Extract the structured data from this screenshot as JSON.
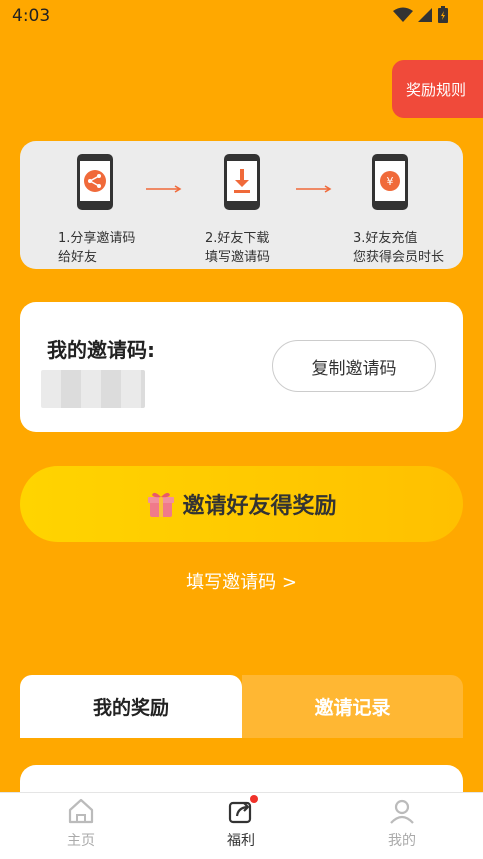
{
  "status_bar": {
    "time": "4:03"
  },
  "rules_button": {
    "label": "奖励规则"
  },
  "steps": [
    {
      "line1": "1.分享邀请码",
      "line2": "给好友",
      "icon": "share-phone-icon"
    },
    {
      "line1": "2.好友下载",
      "line2": "填写邀请码",
      "icon": "download-phone-icon"
    },
    {
      "line1": "3.好友充值",
      "line2": "您获得会员时长",
      "icon": "yuan-phone-icon"
    }
  ],
  "invite_code_card": {
    "title": "我的邀请码:",
    "copy_label": "复制邀请码"
  },
  "invite_button": {
    "label": "邀请好友得奖励",
    "icon": "gift-icon"
  },
  "fill_code_link": {
    "label": "填写邀请码 >"
  },
  "tabs": [
    {
      "label": "我的奖励",
      "active": true
    },
    {
      "label": "邀请记录",
      "active": false
    }
  ],
  "bottom_nav": [
    {
      "label": "主页",
      "icon": "home-icon",
      "active": false
    },
    {
      "label": "福利",
      "icon": "share-box-icon",
      "active": true,
      "badge": true
    },
    {
      "label": "我的",
      "icon": "user-icon",
      "active": false
    }
  ],
  "colors": {
    "background": "#FFA800",
    "rules_button": "#F04A3A",
    "invite_button": "#FFD400",
    "accent_icon": "#F06A3A"
  }
}
